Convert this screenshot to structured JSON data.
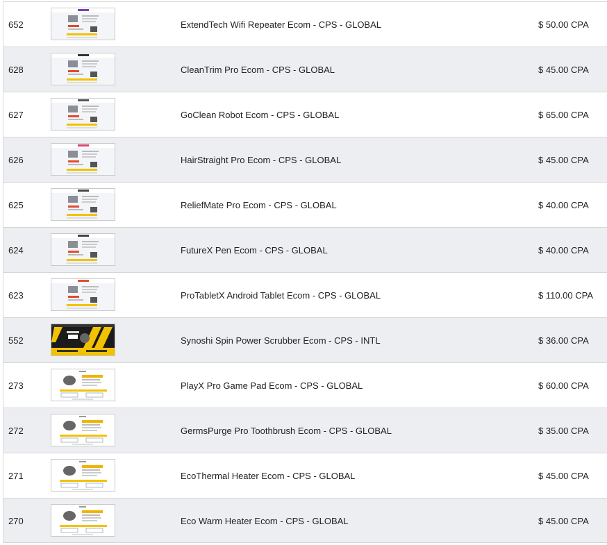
{
  "offers": [
    {
      "id": "652",
      "name": "ExtendTech Wifi Repeater Ecom - CPS - GLOBAL",
      "payout": "$ 50.00 CPA",
      "thumb": "light",
      "logo_color": "#7b3fb8"
    },
    {
      "id": "628",
      "name": "CleanTrim Pro Ecom - CPS - GLOBAL",
      "payout": "$ 45.00 CPA",
      "thumb": "light",
      "logo_color": "#333333"
    },
    {
      "id": "627",
      "name": "GoClean Robot Ecom - CPS - GLOBAL",
      "payout": "$ 65.00 CPA",
      "thumb": "light",
      "logo_color": "#555555"
    },
    {
      "id": "626",
      "name": "HairStraight Pro Ecom - CPS - GLOBAL",
      "payout": "$ 45.00 CPA",
      "thumb": "light",
      "logo_color": "#d9446a"
    },
    {
      "id": "625",
      "name": "ReliefMate Pro Ecom - CPS - GLOBAL",
      "payout": "$ 40.00 CPA",
      "thumb": "light",
      "logo_color": "#444444"
    },
    {
      "id": "624",
      "name": "FutureX Pen Ecom - CPS - GLOBAL",
      "payout": "$ 40.00 CPA",
      "thumb": "light",
      "logo_color": "#444444"
    },
    {
      "id": "623",
      "name": "ProTabletX Android Tablet Ecom - CPS - GLOBAL",
      "payout": "$ 110.00 CPA",
      "thumb": "light",
      "logo_color": "#e0502f"
    },
    {
      "id": "552",
      "name": "Synoshi Spin Power Scrubber Ecom - CPS - INTL",
      "payout": "$ 36.00 CPA",
      "thumb": "dark",
      "logo_color": "#f2c200"
    },
    {
      "id": "273",
      "name": "PlayX Pro Game Pad Ecom - CPS - GLOBAL",
      "payout": "$ 60.00 CPA",
      "thumb": "white",
      "logo_color": "#f0b400"
    },
    {
      "id": "272",
      "name": "GermsPurge Pro Toothbrush Ecom - CPS - GLOBAL",
      "payout": "$ 35.00 CPA",
      "thumb": "white",
      "logo_color": "#f0b400"
    },
    {
      "id": "271",
      "name": "EcoThermal Heater Ecom - CPS - GLOBAL",
      "payout": "$ 45.00 CPA",
      "thumb": "white",
      "logo_color": "#f0b400"
    },
    {
      "id": "270",
      "name": "Eco Warm Heater Ecom - CPS - GLOBAL",
      "payout": "$ 45.00 CPA",
      "thumb": "white",
      "logo_color": "#f0b400"
    }
  ],
  "colors": {
    "row_alt": "#eceef1",
    "border": "#d6d6d6",
    "accent_yellow": "#f2c200",
    "accent_red": "#e04a2f"
  }
}
